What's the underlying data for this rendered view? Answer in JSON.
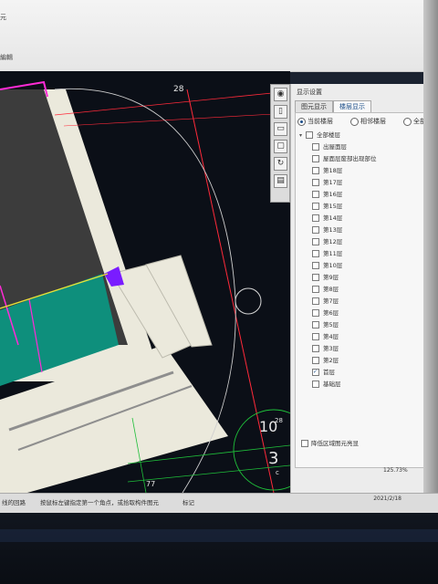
{
  "ribbon": {
    "line1": "元",
    "line2": "編輯"
  },
  "canvas": {
    "label_28_top": "28",
    "label_10": "10",
    "label_28_small": "28",
    "label_3": "3",
    "label_c": "c",
    "label_77": "77"
  },
  "nav_icons": [
    "orbit-icon",
    "page-icon",
    "zoom-icon",
    "pan-icon",
    "rotate-icon",
    "grid-icon"
  ],
  "panel": {
    "title": "显示设置",
    "tabs": [
      "图元显示",
      "楼层显示"
    ],
    "active_tab": 1,
    "radios": [
      {
        "label": "当前楼层",
        "selected": true
      },
      {
        "label": "相邻楼层",
        "selected": false
      },
      {
        "label": "全部楼层",
        "selected": false
      }
    ],
    "root": "全部楼层",
    "floors": [
      {
        "label": "出屋面层",
        "checked": false
      },
      {
        "label": "屋面层废部出现部位",
        "checked": false
      },
      {
        "label": "第18层",
        "checked": false
      },
      {
        "label": "第17层",
        "checked": false
      },
      {
        "label": "第16层",
        "checked": false
      },
      {
        "label": "第15层",
        "checked": false
      },
      {
        "label": "第14层",
        "checked": false
      },
      {
        "label": "第13层",
        "checked": false
      },
      {
        "label": "第12层",
        "checked": false
      },
      {
        "label": "第11层",
        "checked": false
      },
      {
        "label": "第10层",
        "checked": false
      },
      {
        "label": "第9层",
        "checked": false
      },
      {
        "label": "第8层",
        "checked": false
      },
      {
        "label": "第7层",
        "checked": false
      },
      {
        "label": "第6层",
        "checked": false
      },
      {
        "label": "第5层",
        "checked": false
      },
      {
        "label": "第4层",
        "checked": false
      },
      {
        "label": "第3层",
        "checked": false
      },
      {
        "label": "第2层",
        "checked": false
      },
      {
        "label": "首层",
        "checked": true
      },
      {
        "label": "基础层",
        "checked": false
      }
    ],
    "bottom_option": "降低区域图元亮显"
  },
  "status": {
    "left": "线的回路",
    "hint": "按鼠标左键指定第一个角点，或拾取构件图元",
    "middle": "标记",
    "zoom": "125.73%",
    "date": "2021/2/18"
  },
  "colors": {
    "canvas_bg": "#0b0f17",
    "wall": "#ebe9dc",
    "teal": "#0e8f7c",
    "magenta": "#ff2bd6",
    "red_axis": "#ff2a3a",
    "green": "#1fbf3a",
    "yellow": "#e6e238",
    "purple": "#7a1cff"
  }
}
